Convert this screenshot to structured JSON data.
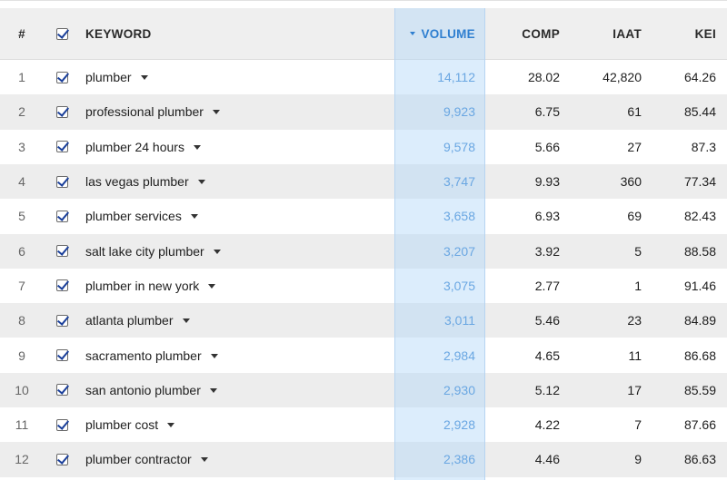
{
  "header": {
    "num": "#",
    "keyword": "KEYWORD",
    "volume": "VOLUME",
    "comp": "COMP",
    "iaat": "IAAT",
    "kei": "KEI"
  },
  "icons": {
    "checkbox": "checkbox-checked-icon",
    "dropdown": "caret-down-icon",
    "sort": "sort-descending-icon"
  },
  "colors": {
    "accent": "#2f7fd0",
    "checkmark": "#1a3f9a",
    "row_alt": "#ededed"
  },
  "rows": [
    {
      "num": "1",
      "keyword": "plumber",
      "volume": "14,112",
      "comp": "28.02",
      "iaat": "42,820",
      "kei": "64.26"
    },
    {
      "num": "2",
      "keyword": "professional plumber",
      "volume": "9,923",
      "comp": "6.75",
      "iaat": "61",
      "kei": "85.44"
    },
    {
      "num": "3",
      "keyword": "plumber 24 hours",
      "volume": "9,578",
      "comp": "5.66",
      "iaat": "27",
      "kei": "87.3"
    },
    {
      "num": "4",
      "keyword": "las vegas plumber",
      "volume": "3,747",
      "comp": "9.93",
      "iaat": "360",
      "kei": "77.34"
    },
    {
      "num": "5",
      "keyword": "plumber services",
      "volume": "3,658",
      "comp": "6.93",
      "iaat": "69",
      "kei": "82.43"
    },
    {
      "num": "6",
      "keyword": "salt lake city plumber",
      "volume": "3,207",
      "comp": "3.92",
      "iaat": "5",
      "kei": "88.58"
    },
    {
      "num": "7",
      "keyword": "plumber in new york",
      "volume": "3,075",
      "comp": "2.77",
      "iaat": "1",
      "kei": "91.46"
    },
    {
      "num": "8",
      "keyword": "atlanta plumber",
      "volume": "3,011",
      "comp": "5.46",
      "iaat": "23",
      "kei": "84.89"
    },
    {
      "num": "9",
      "keyword": "sacramento plumber",
      "volume": "2,984",
      "comp": "4.65",
      "iaat": "11",
      "kei": "86.68"
    },
    {
      "num": "10",
      "keyword": "san antonio plumber",
      "volume": "2,930",
      "comp": "5.12",
      "iaat": "17",
      "kei": "85.59"
    },
    {
      "num": "11",
      "keyword": "plumber cost",
      "volume": "2,928",
      "comp": "4.22",
      "iaat": "7",
      "kei": "87.66"
    },
    {
      "num": "12",
      "keyword": "plumber contractor",
      "volume": "2,386",
      "comp": "4.46",
      "iaat": "9",
      "kei": "86.63"
    }
  ]
}
